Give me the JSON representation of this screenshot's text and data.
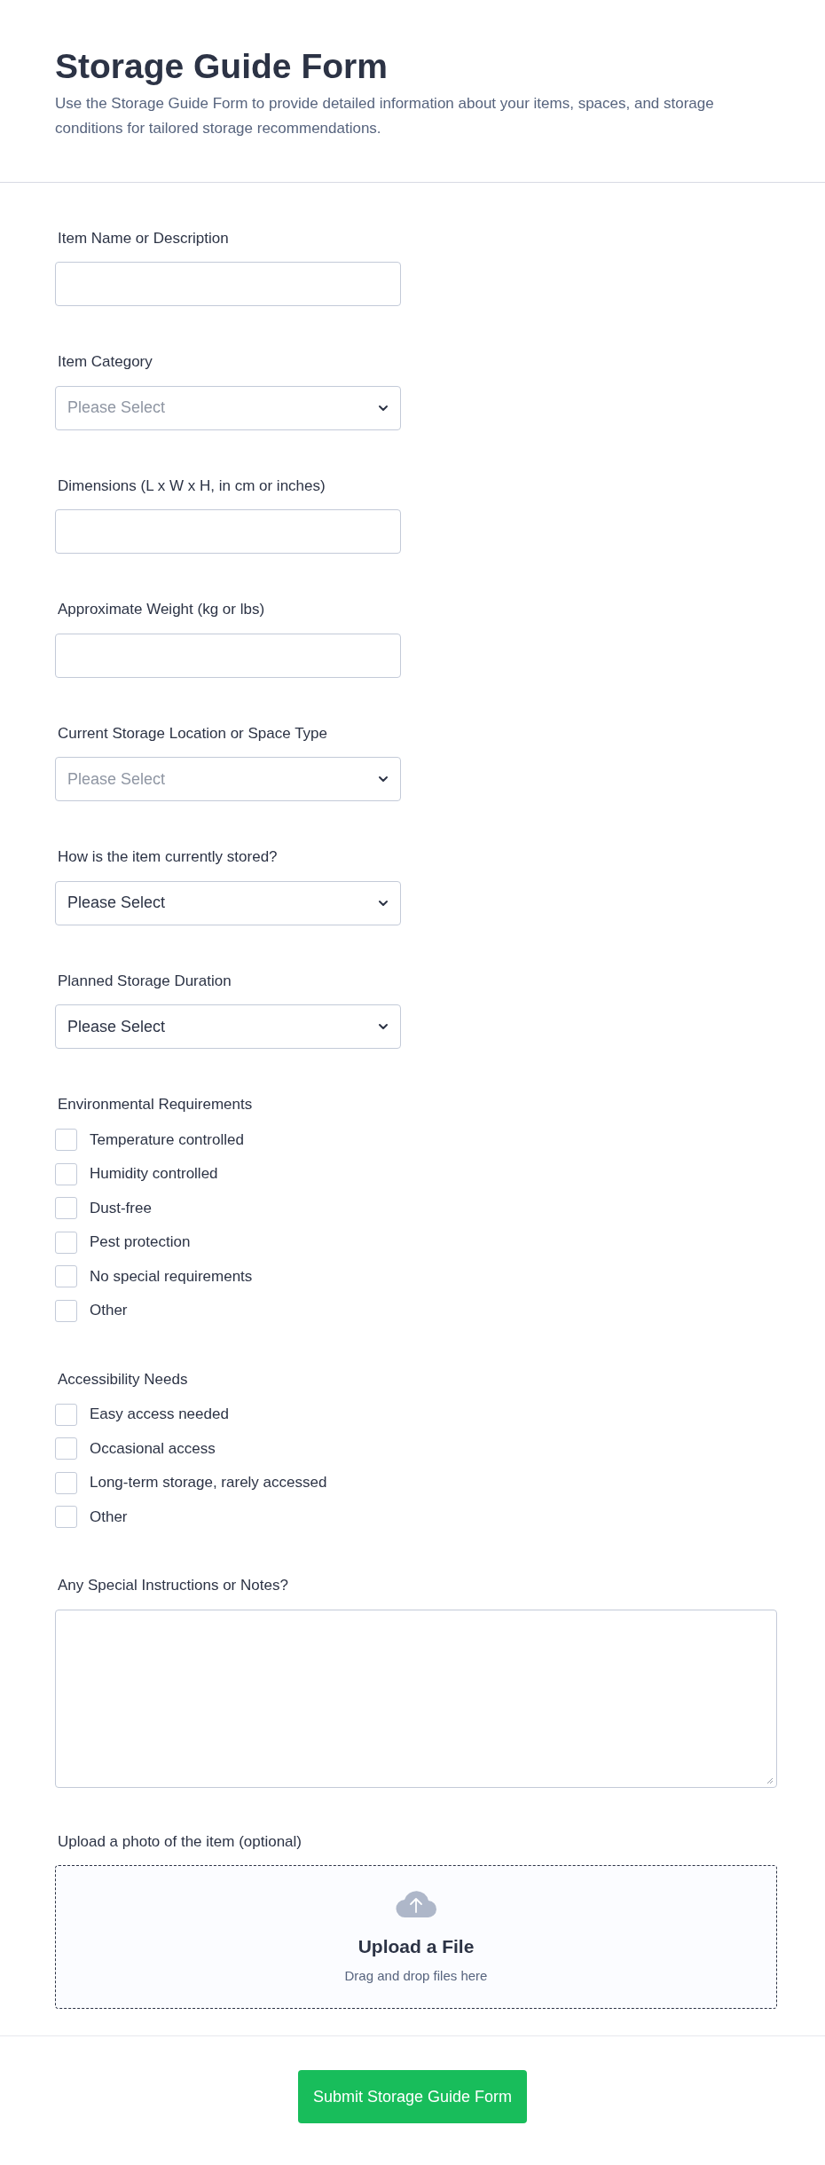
{
  "header": {
    "title": "Storage Guide Form",
    "description": "Use the Storage Guide Form to provide detailed information about your items, spaces, and storage conditions for tailored storage recommendations."
  },
  "fields": [
    {
      "kind": "text",
      "label": "Item Name or Description"
    },
    {
      "kind": "select",
      "label": "Item Category",
      "placeholder": "Please Select"
    },
    {
      "kind": "text",
      "label": "Dimensions (L x W x H, in cm or inches)"
    },
    {
      "kind": "text",
      "label": "Approximate Weight (kg or lbs)"
    },
    {
      "kind": "select",
      "label": "Current Storage Location or Space Type",
      "placeholder": "Please Select"
    },
    {
      "kind": "select",
      "label": "How is the item currently stored?",
      "value": "Please Select"
    },
    {
      "kind": "select",
      "label": "Planned Storage Duration",
      "value": "Please Select"
    },
    {
      "kind": "checkboxes",
      "label": "Environmental Requirements",
      "options": [
        {
          "label": "Temperature controlled",
          "checked": false
        },
        {
          "label": "Humidity controlled",
          "checked": false
        },
        {
          "label": "Dust-free",
          "checked": false
        },
        {
          "label": "Pest protection",
          "checked": false
        },
        {
          "label": "No special requirements",
          "checked": false
        },
        {
          "label": "Other",
          "checked": false
        }
      ]
    },
    {
      "kind": "checkboxes",
      "label": "Accessibility Needs",
      "options": [
        {
          "label": "Easy access needed",
          "checked": false
        },
        {
          "label": "Occasional access",
          "checked": false
        },
        {
          "label": "Long-term storage, rarely accessed",
          "checked": false
        },
        {
          "label": "Other",
          "checked": false
        }
      ]
    },
    {
      "kind": "textarea",
      "label": "Any Special Instructions or Notes?"
    },
    {
      "kind": "upload",
      "label": "Upload a photo of the item (optional)",
      "title": "Upload a File",
      "hint": "Drag and drop files here"
    }
  ],
  "submit": {
    "label": "Submit Storage Guide Form"
  }
}
